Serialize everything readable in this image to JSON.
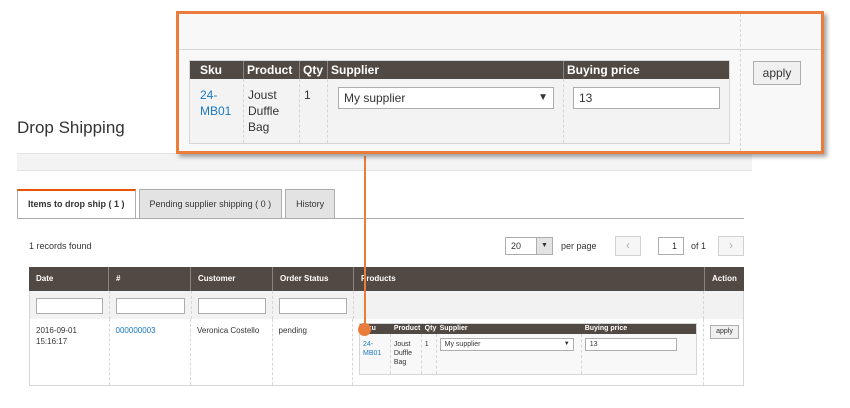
{
  "page": {
    "title": "Drop Shipping"
  },
  "tabs": [
    {
      "label": "Items to drop ship ( 1 )",
      "active": true
    },
    {
      "label": "Pending supplier shipping ( 0 )",
      "active": false
    },
    {
      "label": "History",
      "active": false
    }
  ],
  "toolbar": {
    "records_found": "1 records found",
    "per_page_value": "20",
    "per_page_label": "per page",
    "prev_icon": "‹",
    "next_icon": "›",
    "current_page": "1",
    "page_of": "of 1"
  },
  "grid": {
    "columns": [
      "Date",
      "#",
      "Customer",
      "Order Status",
      "Products",
      "Action"
    ],
    "rows": [
      {
        "date": "2016-09-01 15:16:17",
        "order_number": "000000003",
        "customer": "Veronica Costello",
        "status": "pending",
        "action_label": "apply"
      }
    ]
  },
  "products_table": {
    "columns": [
      "Sku",
      "Product",
      "Qty",
      "Supplier",
      "Buying price"
    ],
    "sku": "24-MB01",
    "sku_line1": "24-",
    "sku_line2": "MB01",
    "product_line1": "Joust",
    "product_line2": "Duffle",
    "product_line3": "Bag",
    "qty": "1",
    "supplier": "My supplier",
    "buying_price": "13",
    "apply_label": "apply"
  },
  "colors": {
    "accent": "#eb7d3c",
    "header_bg": "#514943",
    "link": "#1979c3"
  }
}
